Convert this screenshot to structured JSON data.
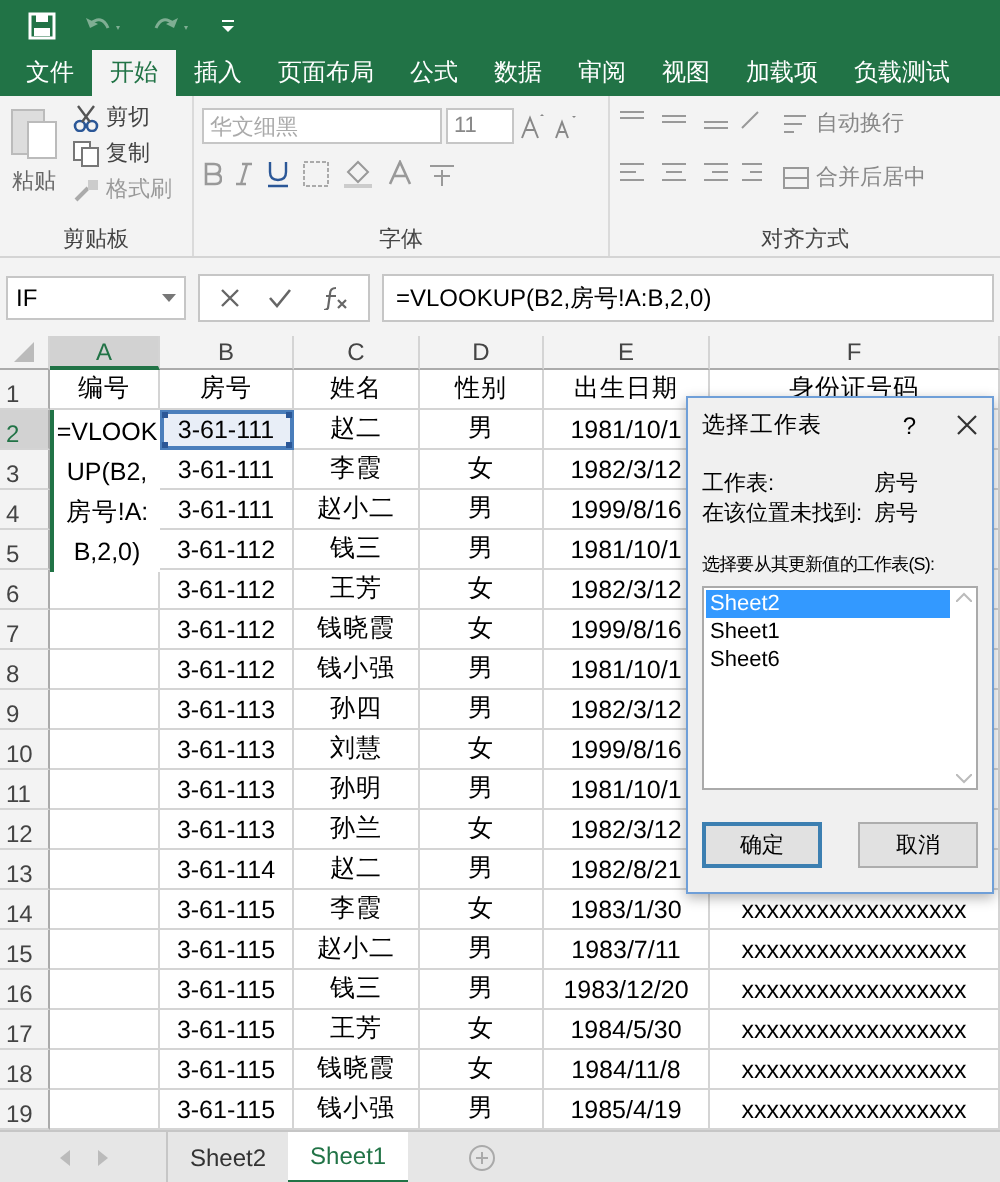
{
  "ribbon_tabs": [
    {
      "label": "文件",
      "selected": false
    },
    {
      "label": "开始",
      "selected": true
    },
    {
      "label": "插入",
      "selected": false
    },
    {
      "label": "页面布局",
      "selected": false
    },
    {
      "label": "公式",
      "selected": false
    },
    {
      "label": "数据",
      "selected": false
    },
    {
      "label": "审阅",
      "selected": false
    },
    {
      "label": "视图",
      "selected": false
    },
    {
      "label": "加载项",
      "selected": false
    },
    {
      "label": "负载测试",
      "selected": false
    }
  ],
  "ribbon": {
    "clipboard": {
      "paste": "粘贴",
      "cut": "剪切",
      "copy": "复制",
      "format_painter": "格式刷",
      "label": "剪贴板"
    },
    "font": {
      "font_name": "华文细黑",
      "font_size": "11",
      "label": "字体"
    },
    "alignment": {
      "wrap_text": "自动换行",
      "merge_center": "合并后居中",
      "label": "对齐方式"
    }
  },
  "formula_bar": {
    "name_box": "IF",
    "formula": "=VLOOKUP(B2,房号!A:B,2,0)"
  },
  "sheet": {
    "columns": [
      {
        "label": "A",
        "selected": true
      },
      {
        "label": "B",
        "selected": false
      },
      {
        "label": "C",
        "selected": false
      },
      {
        "label": "D",
        "selected": false
      },
      {
        "label": "E",
        "selected": false
      },
      {
        "label": "F",
        "selected": false
      }
    ],
    "rows": [
      {
        "number": "1",
        "selected": false,
        "cells": [
          "编号",
          "房号",
          "姓名",
          "性别",
          "出生日期",
          "身份证号码"
        ]
      },
      {
        "number": "2",
        "selected": true,
        "cells": [
          {
            "text": "=VLOOKUP(B2,房号!A:B,2,0)",
            "editing": true
          },
          {
            "text": "3-61-111",
            "referenced": true
          },
          "赵二",
          "男",
          "1981/10/1",
          ""
        ]
      },
      {
        "number": "3",
        "selected": false,
        "cells": [
          "",
          "3-61-111",
          "李霞",
          "女",
          "1982/3/12",
          ""
        ]
      },
      {
        "number": "4",
        "selected": false,
        "cells": [
          "",
          "3-61-111",
          "赵小二",
          "男",
          "1999/8/16",
          ""
        ]
      },
      {
        "number": "5",
        "selected": false,
        "cells": [
          "",
          "3-61-112",
          "钱三",
          "男",
          "1981/10/1",
          ""
        ]
      },
      {
        "number": "6",
        "selected": false,
        "cells": [
          "",
          "3-61-112",
          "王芳",
          "女",
          "1982/3/12",
          ""
        ]
      },
      {
        "number": "7",
        "selected": false,
        "cells": [
          "",
          "3-61-112",
          "钱晓霞",
          "女",
          "1999/8/16",
          ""
        ]
      },
      {
        "number": "8",
        "selected": false,
        "cells": [
          "",
          "3-61-112",
          "钱小强",
          "男",
          "1981/10/1",
          ""
        ]
      },
      {
        "number": "9",
        "selected": false,
        "cells": [
          "",
          "3-61-113",
          "孙四",
          "男",
          "1982/3/12",
          ""
        ]
      },
      {
        "number": "10",
        "selected": false,
        "cells": [
          "",
          "3-61-113",
          "刘慧",
          "女",
          "1999/8/16",
          ""
        ]
      },
      {
        "number": "11",
        "selected": false,
        "cells": [
          "",
          "3-61-113",
          "孙明",
          "男",
          "1981/10/1",
          ""
        ]
      },
      {
        "number": "12",
        "selected": false,
        "cells": [
          "",
          "3-61-113",
          "孙兰",
          "女",
          "1982/3/12",
          ""
        ]
      },
      {
        "number": "13",
        "selected": false,
        "cells": [
          "",
          "3-61-114",
          "赵二",
          "男",
          "1982/8/21",
          ""
        ]
      },
      {
        "number": "14",
        "selected": false,
        "cells": [
          "",
          "3-61-115",
          "李霞",
          "女",
          "1983/1/30",
          "xxxxxxxxxxxxxxxxxx"
        ]
      },
      {
        "number": "15",
        "selected": false,
        "cells": [
          "",
          "3-61-115",
          "赵小二",
          "男",
          "1983/7/11",
          "xxxxxxxxxxxxxxxxxx"
        ]
      },
      {
        "number": "16",
        "selected": false,
        "cells": [
          "",
          "3-61-115",
          "钱三",
          "男",
          "1983/12/20",
          "xxxxxxxxxxxxxxxxxx"
        ]
      },
      {
        "number": "17",
        "selected": false,
        "cells": [
          "",
          "3-61-115",
          "王芳",
          "女",
          "1984/5/30",
          "xxxxxxxxxxxxxxxxxx"
        ]
      },
      {
        "number": "18",
        "selected": false,
        "cells": [
          "",
          "3-61-115",
          "钱晓霞",
          "女",
          "1984/11/8",
          "xxxxxxxxxxxxxxxxxx"
        ]
      },
      {
        "number": "19",
        "selected": false,
        "cells": [
          "",
          "3-61-115",
          "钱小强",
          "男",
          "1985/4/19",
          "xxxxxxxxxxxxxxxxxx"
        ]
      }
    ]
  },
  "dialog": {
    "title": "选择工作表",
    "help": "?",
    "info": [
      {
        "label": "工作表:",
        "value": "房号"
      },
      {
        "label": "在该位置未找到:",
        "value": "房号"
      }
    ],
    "list_label": "选择要从其更新值的工作表(S):",
    "sheets": [
      {
        "name": "Sheet2",
        "selected": true
      },
      {
        "name": "Sheet1",
        "selected": false
      },
      {
        "name": "Sheet6",
        "selected": false
      }
    ],
    "buttons": [
      {
        "label": "确定",
        "kind": "default"
      },
      {
        "label": "取消",
        "kind": "normal"
      }
    ]
  },
  "sheet_tabs": [
    {
      "label": "Sheet2",
      "selected": false
    },
    {
      "label": "Sheet1",
      "selected": true
    }
  ]
}
